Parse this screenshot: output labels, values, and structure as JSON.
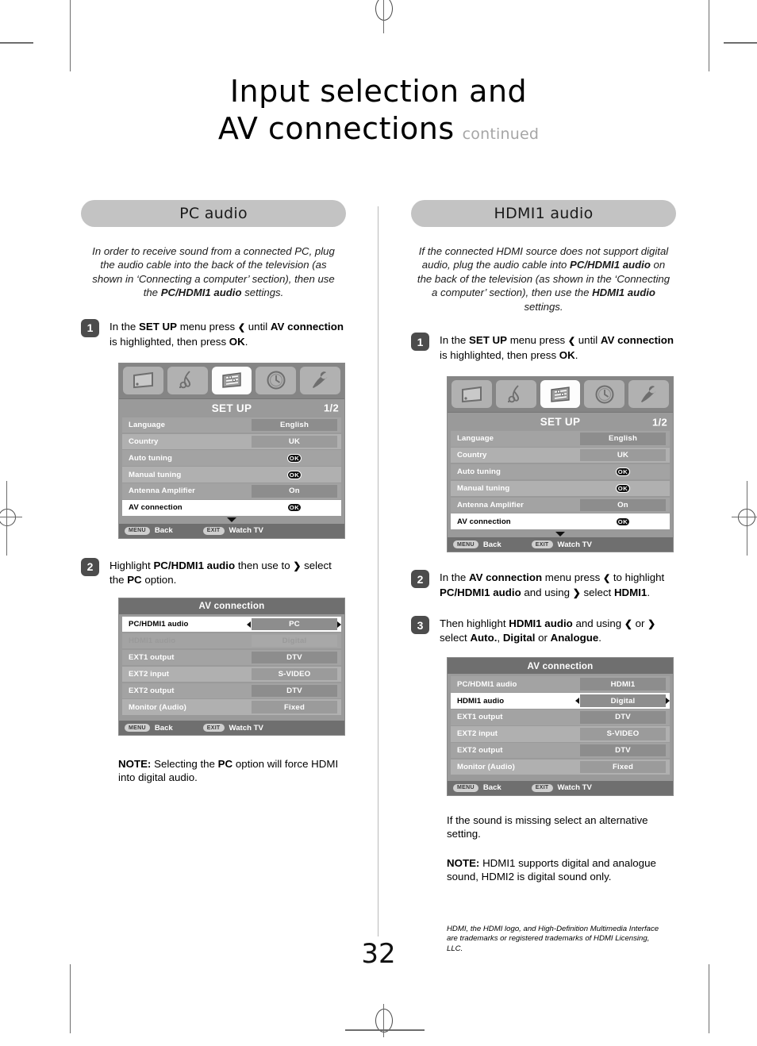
{
  "page": {
    "number": "32",
    "title_line1": "Input selection and",
    "title_line2": "AV connections",
    "title_continued": "continued"
  },
  "left_column": {
    "banner": "PC audio",
    "intro_parts": {
      "p1": "In order to receive sound from a connected PC, plug the audio cable into the back of the television (as shown in ‘Connecting a computer’ section), then use the ",
      "b1": "PC/HDMI1 audio",
      "p2": " settings."
    },
    "step1": {
      "number": "1",
      "t1": "In the ",
      "b1": "SET UP",
      "t2": " menu press ",
      "icon": "chevron-down",
      "t3": " until ",
      "b2": "AV connection",
      "t4": " is highlighted, then press ",
      "b3": "OK",
      "t5": "."
    },
    "step2": {
      "number": "2",
      "t1": "Highlight ",
      "b1": "PC/HDMI1 audio",
      "t2": " then use to ",
      "icon": "chevron-right",
      "t3": " select the ",
      "b2": "PC",
      "t4": " option."
    },
    "note": {
      "bold": "NOTE:",
      "text": " Selecting the PC option will force HDMI into digital audio.",
      "t1": " Selecting the ",
      "b1": "PC",
      "t2": " option will force HDMI into digital audio."
    },
    "setup_menu": {
      "title": "SET UP",
      "page_indicator": "1/2",
      "icons": [
        "picture-icon",
        "sound-icon",
        "setup-icon",
        "timer-icon",
        "tools-icon"
      ],
      "active_icon_index": 2,
      "rows": [
        {
          "label": "Language",
          "value": "English",
          "type": "value",
          "state": "normal"
        },
        {
          "label": "Country",
          "value": "UK",
          "type": "value",
          "state": "alt"
        },
        {
          "label": "Auto tuning",
          "value": "OK",
          "type": "ok",
          "state": "normal"
        },
        {
          "label": "Manual tuning",
          "value": "OK",
          "type": "ok",
          "state": "alt"
        },
        {
          "label": "Antenna Amplifier",
          "value": "On",
          "type": "value",
          "state": "normal"
        },
        {
          "label": "AV connection",
          "value": "OK",
          "type": "ok",
          "state": "selected"
        }
      ],
      "footer": {
        "menu_key": "MENU",
        "menu_label": "Back",
        "exit_key": "EXIT",
        "exit_label": "Watch TV"
      }
    },
    "av_menu": {
      "title": "AV connection",
      "rows": [
        {
          "label": "PC/HDMI1 audio",
          "value": "PC",
          "state": "selected",
          "arrows": true
        },
        {
          "label": "HDMI1 audio",
          "value": "Digital",
          "state": "dim",
          "arrows": false
        },
        {
          "label": "EXT1 output",
          "value": "DTV",
          "state": "normal",
          "arrows": false
        },
        {
          "label": "EXT2 input",
          "value": "S-VIDEO",
          "state": "alt",
          "arrows": false
        },
        {
          "label": "EXT2 output",
          "value": "DTV",
          "state": "normal",
          "arrows": false
        },
        {
          "label": "Monitor (Audio)",
          "value": "Fixed",
          "state": "alt",
          "arrows": false
        }
      ],
      "footer": {
        "menu_key": "MENU",
        "menu_label": "Back",
        "exit_key": "EXIT",
        "exit_label": "Watch TV"
      }
    }
  },
  "right_column": {
    "banner": "HDMI1 audio",
    "intro_parts": {
      "p1": "If the connected HDMI source does not support digital audio, plug the audio cable into ",
      "b1": "PC/HDMI1 audio",
      "p2": " on the back of the television (as shown in the ‘Connecting a computer’ section), then use the ",
      "b2": "HDMI1 audio",
      "p3": " settings."
    },
    "step1": {
      "number": "1",
      "t1": "In the ",
      "b1": "SET UP",
      "t2": " menu press ",
      "t3": " until ",
      "b2": "AV connection",
      "t4": " is highlighted, then press ",
      "b3": "OK",
      "t5": "."
    },
    "step2": {
      "number": "2",
      "t1": "In the ",
      "b1": "AV connection",
      "t2": " menu press ",
      "t3": " to highlight ",
      "b2": "PC/HDMI1 audio",
      "t4": " and using ",
      "t5": " select ",
      "b3": "HDMI1",
      "t6": "."
    },
    "step3": {
      "number": "3",
      "t1": "Then highlight ",
      "b1": "HDMI1 audio",
      "t2": " and using ",
      "t3": " or ",
      "t4": " select ",
      "b2": "Auto.",
      "t5": ", ",
      "b3": "Digital",
      "t6": " or ",
      "b4": "Analogue",
      "t7": "."
    },
    "after_text": "If the sound is missing select an alternative setting.",
    "note": {
      "bold": "NOTE:",
      "t1": " HDMI1 supports digital and analogue sound, HDMI2 is digital sound only."
    },
    "footnote": "HDMI, the HDMI logo, and High-Definition Multimedia Interface are trademarks or registered trademarks of HDMI Licensing, LLC.",
    "setup_menu": {
      "title": "SET UP",
      "page_indicator": "1/2",
      "rows": [
        {
          "label": "Language",
          "value": "English",
          "type": "value",
          "state": "normal"
        },
        {
          "label": "Country",
          "value": "UK",
          "type": "value",
          "state": "alt"
        },
        {
          "label": "Auto tuning",
          "value": "OK",
          "type": "ok",
          "state": "normal"
        },
        {
          "label": "Manual tuning",
          "value": "OK",
          "type": "ok",
          "state": "alt"
        },
        {
          "label": "Antenna Amplifier",
          "value": "On",
          "type": "value",
          "state": "normal"
        },
        {
          "label": "AV connection",
          "value": "OK",
          "type": "ok",
          "state": "selected"
        }
      ],
      "footer": {
        "menu_key": "MENU",
        "menu_label": "Back",
        "exit_key": "EXIT",
        "exit_label": "Watch TV"
      }
    },
    "av_menu": {
      "title": "AV connection",
      "rows": [
        {
          "label": "PC/HDMI1 audio",
          "value": "HDMI1",
          "state": "normal",
          "arrows": false
        },
        {
          "label": "HDMI1 audio",
          "value": "Digital",
          "state": "selected",
          "arrows": true
        },
        {
          "label": "EXT1 output",
          "value": "DTV",
          "state": "normal",
          "arrows": false
        },
        {
          "label": "EXT2 input",
          "value": "S-VIDEO",
          "state": "alt",
          "arrows": false
        },
        {
          "label": "EXT2 output",
          "value": "DTV",
          "state": "normal",
          "arrows": false
        },
        {
          "label": "Monitor (Audio)",
          "value": "Fixed",
          "state": "alt",
          "arrows": false
        }
      ],
      "footer": {
        "menu_key": "MENU",
        "menu_label": "Back",
        "exit_key": "EXIT",
        "exit_label": "Watch TV"
      }
    }
  }
}
